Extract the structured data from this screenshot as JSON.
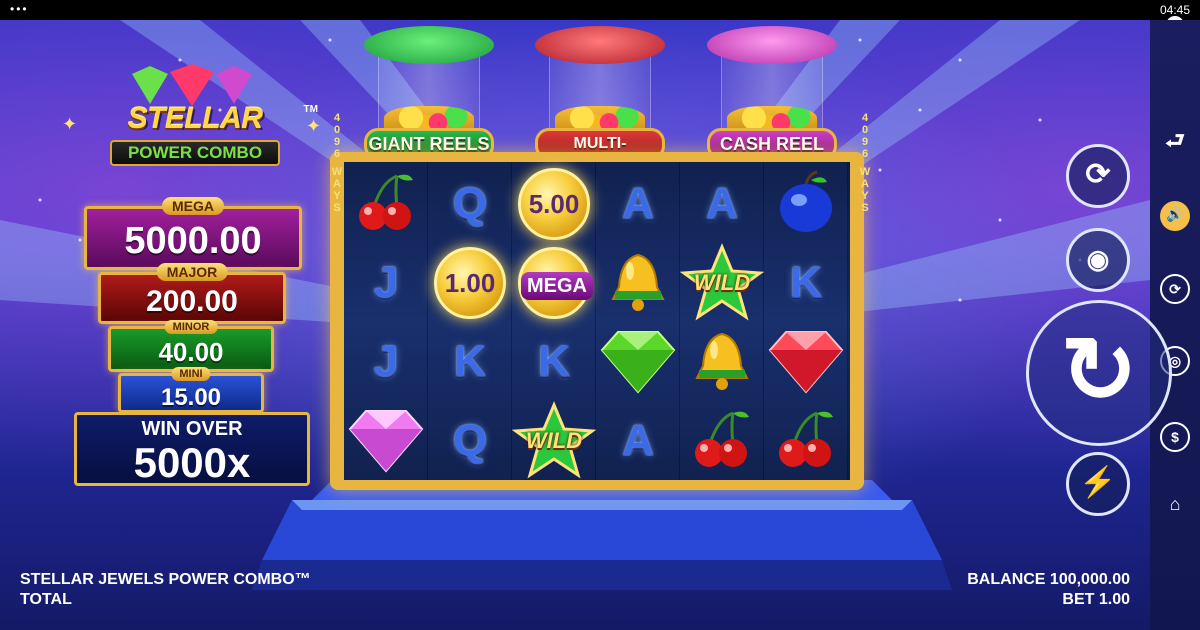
{
  "system": {
    "clock": "04:45",
    "menu_dots": "•••",
    "close_label": "✕"
  },
  "logo": {
    "title": "STELLAR JEWELS",
    "tm": "TM",
    "subtitle": "POWER COMBO"
  },
  "jackpots": [
    {
      "label": "MEGA",
      "value": "5000.00"
    },
    {
      "label": "MAJOR",
      "value": "200.00"
    },
    {
      "label": "MINOR",
      "value": "40.00"
    },
    {
      "label": "MINI",
      "value": "15.00"
    }
  ],
  "win_over": {
    "label": "WIN OVER",
    "value": "5000x"
  },
  "features": [
    {
      "label": "GIANT REELS",
      "color": "#2ab84a"
    },
    {
      "label": "MULTI-COLLECT",
      "color": "#e03a3a"
    },
    {
      "label": "CASH REEL",
      "color": "#d040c8"
    }
  ],
  "ways": {
    "left": [
      "4",
      "0",
      "9",
      "6",
      "W",
      "A",
      "Y",
      "S"
    ],
    "right": [
      "4",
      "0",
      "9",
      "6",
      "W",
      "A",
      "Y",
      "S"
    ]
  },
  "grid": [
    [
      {
        "type": "cherry"
      },
      {
        "type": "letter",
        "text": "Q"
      },
      {
        "type": "coin",
        "text": "5.00"
      },
      {
        "type": "letter",
        "text": "A"
      },
      {
        "type": "letter",
        "text": "A"
      },
      {
        "type": "plum"
      }
    ],
    [
      {
        "type": "letter",
        "text": "J"
      },
      {
        "type": "coin",
        "text": "1.00"
      },
      {
        "type": "coin_mega",
        "text": "MEGA"
      },
      {
        "type": "bell"
      },
      {
        "type": "wild",
        "text": "WILD"
      },
      {
        "type": "letter",
        "text": "K"
      }
    ],
    [
      {
        "type": "letter",
        "text": "J"
      },
      {
        "type": "letter",
        "text": "K"
      },
      {
        "type": "letter",
        "text": "K"
      },
      {
        "type": "green_gem"
      },
      {
        "type": "bell"
      },
      {
        "type": "red_gem"
      }
    ],
    [
      {
        "type": "pink_gem"
      },
      {
        "type": "letter",
        "text": "Q"
      },
      {
        "type": "wild",
        "text": "WILD"
      },
      {
        "type": "letter",
        "text": "A"
      },
      {
        "type": "cherry"
      },
      {
        "type": "cherry"
      }
    ]
  ],
  "controls": {
    "back_icon": "⮐",
    "sound_icon": "🔊",
    "autoplay_small_icon": "⟳",
    "coins_icon": "◎",
    "money_icon": "$",
    "home_icon": "⌂",
    "autoplay_icon": "⟳",
    "stake_icon": "◉",
    "spin_icon": "↻",
    "turbo_icon": "⚡"
  },
  "footer": {
    "game_name": "STELLAR JEWELS POWER COMBO™",
    "total_label": "TOTAL",
    "balance": "BALANCE 100,000.00",
    "bet": "BET 1.00"
  }
}
